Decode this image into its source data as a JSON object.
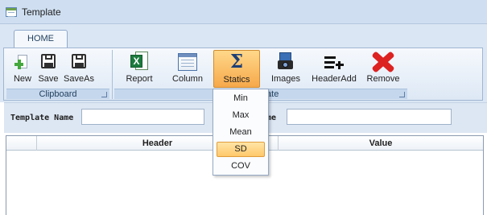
{
  "window": {
    "title": "Template"
  },
  "ribbon": {
    "tabs": [
      {
        "label": "HOME"
      }
    ],
    "groups": {
      "clipboard": {
        "label": "Clipboard",
        "buttons": [
          {
            "label": "New",
            "icon": "new-document-icon"
          },
          {
            "label": "Save",
            "icon": "floppy-disk-icon"
          },
          {
            "label": "SaveAs",
            "icon": "floppy-disk-icon"
          }
        ]
      },
      "template": {
        "label": "Template",
        "buttons": [
          {
            "label": "Report",
            "icon": "excel-icon"
          },
          {
            "label": "Column",
            "icon": "table-column-icon"
          },
          {
            "label": "Statics",
            "icon": "sigma-icon"
          },
          {
            "label": "Images",
            "icon": "camera-icon"
          },
          {
            "label": "HeaderAdd",
            "icon": "list-add-icon"
          },
          {
            "label": "Remove",
            "icon": "red-x-icon"
          }
        ]
      }
    }
  },
  "statics_menu": {
    "items": [
      {
        "label": "Min"
      },
      {
        "label": "Max"
      },
      {
        "label": "Mean"
      },
      {
        "label": "SD"
      },
      {
        "label": "COV"
      }
    ],
    "selected": "SD"
  },
  "form": {
    "template_name_label": "Template Name",
    "template_name_value": "",
    "second_label_visible": "ame",
    "second_value": ""
  },
  "grid": {
    "columns": [
      "",
      "Header",
      "Value"
    ],
    "rows": []
  },
  "colors": {
    "titlebar": "#cfdff1",
    "ribbon": "#dbe6f4",
    "accent_selected": "#ffc86b",
    "remove_icon": "#dd2222"
  }
}
